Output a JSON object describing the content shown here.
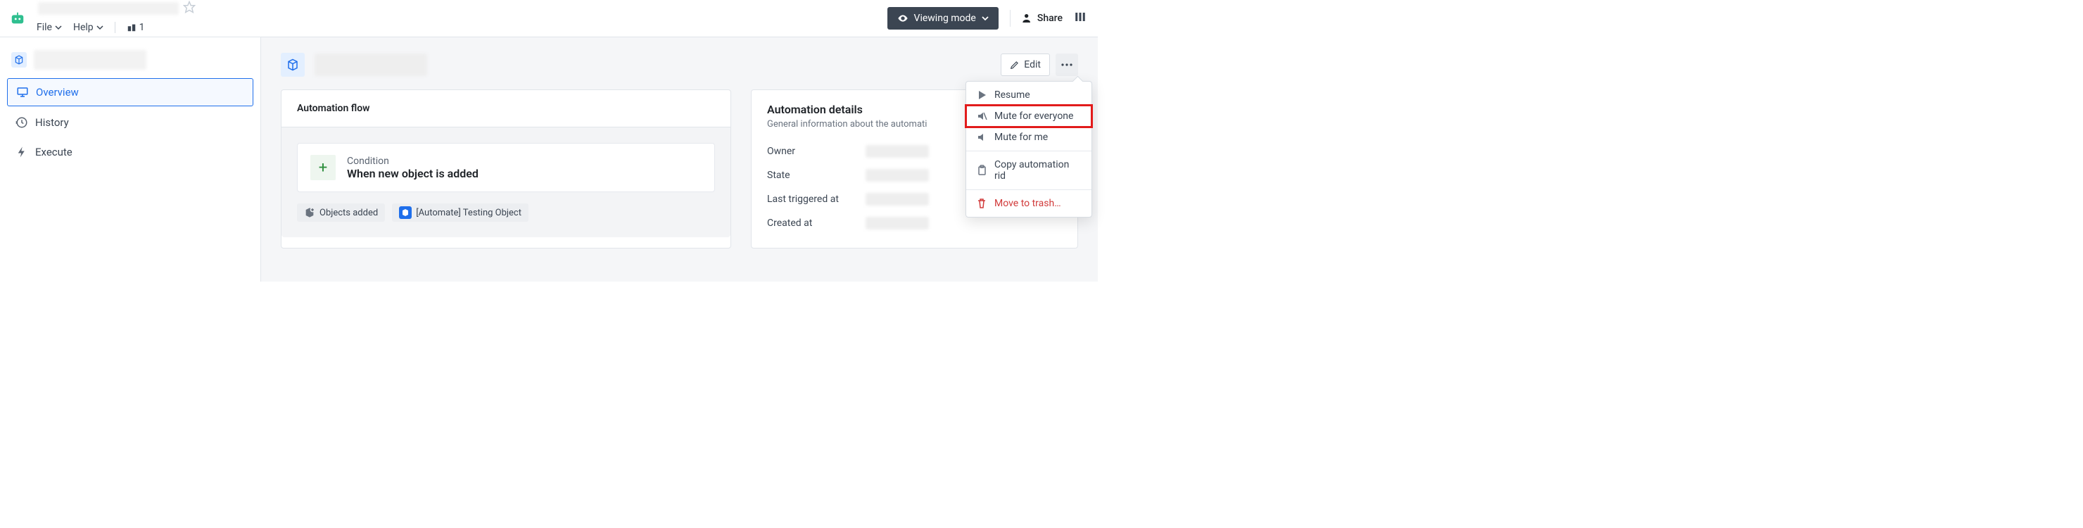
{
  "topbar": {
    "viewing_mode": "Viewing mode",
    "share": "Share",
    "menu": {
      "file": "File",
      "help": "Help",
      "count": "1"
    }
  },
  "sidebar": {
    "overview": "Overview",
    "history": "History",
    "execute": "Execute"
  },
  "actions": {
    "edit": "Edit"
  },
  "flow": {
    "title": "Automation flow",
    "condition_label": "Condition",
    "condition_text": "When new object is added",
    "chip_objects": "Objects added",
    "chip_testing": "[Automate] Testing Object"
  },
  "details": {
    "title": "Automation details",
    "subtitle": "General information about the automati",
    "rows": {
      "owner": "Owner",
      "state": "State",
      "last_triggered": "Last triggered at",
      "created": "Created at"
    }
  },
  "menu": {
    "resume": "Resume",
    "mute_everyone": "Mute for everyone",
    "mute_me": "Mute for me",
    "copy_rid": "Copy automation rid",
    "move_trash": "Move to trash…"
  }
}
